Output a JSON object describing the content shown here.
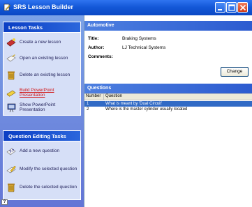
{
  "window": {
    "title": "SRS Lesson Builder"
  },
  "lesson_tasks": {
    "header": "Lesson Tasks",
    "items": [
      {
        "label": "Create a new lesson",
        "icon": "create-lesson-icon"
      },
      {
        "label": "Open an existing lesson",
        "icon": "open-lesson-icon"
      },
      {
        "label": "Delete an existing lesson",
        "icon": "delete-lesson-icon"
      },
      {
        "label": "Build PowerPoint Presentation",
        "icon": "build-presentation-icon"
      },
      {
        "label": "Show PowerPoint Presentation",
        "icon": "show-presentation-icon"
      }
    ]
  },
  "question_tasks": {
    "header": "Question Editing Tasks",
    "items": [
      {
        "label": "Add a new question",
        "icon": "add-question-icon"
      },
      {
        "label": "Modify the selected question",
        "icon": "modify-question-icon"
      },
      {
        "label": "Delete the selected question",
        "icon": "delete-question-icon"
      }
    ]
  },
  "help": {
    "label": "?"
  },
  "lesson": {
    "header": "Automotive",
    "title_label": "Title:",
    "title_value": "Braking Systems",
    "author_label": "Author:",
    "author_value": "LJ Technical Systems",
    "comments_label": "Comments:",
    "change_label": "Change"
  },
  "questions": {
    "header": "Questions",
    "columns": [
      "Number",
      "Question"
    ],
    "rows": [
      {
        "number": "1",
        "question": "What is meant by 'Dual Circuit'",
        "selected": true
      },
      {
        "number": "2",
        "question": "Where is the master cylinder usually located",
        "selected": false
      }
    ]
  },
  "colors": {
    "titlebar": "#0a48c4",
    "task_header": "#0a3ec4",
    "selection": "#316ac5",
    "active_link": "#d21414"
  }
}
